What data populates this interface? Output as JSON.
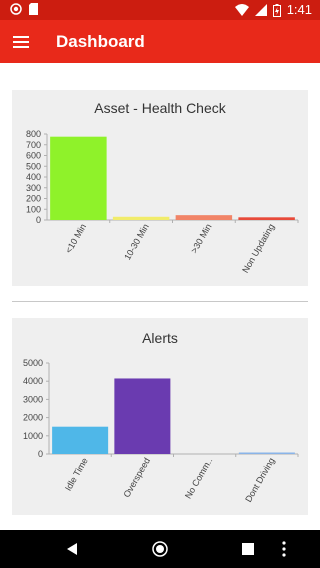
{
  "status_bar": {
    "time": "1:41",
    "icons": [
      "notification-icon",
      "sd-card-icon",
      "wifi-icon",
      "signal-icon",
      "battery-icon"
    ]
  },
  "app_bar": {
    "title": "Dashboard",
    "menu_icon": "hamburger-menu-icon"
  },
  "colors": {
    "status_bar": "#cc1d10",
    "app_bar": "#e8291a",
    "card_bg": "#efefef"
  },
  "chart_data": [
    {
      "type": "bar",
      "title": "Asset - Health Check",
      "categories": [
        "<10 Min",
        "10-30 Min",
        ">30 Min",
        "Non Updating"
      ],
      "values": [
        775,
        30,
        45,
        25
      ],
      "colors": [
        "#8ff22a",
        "#f1ec6a",
        "#f18467",
        "#e84a3a"
      ],
      "yticks": [
        "0",
        "100",
        "200",
        "300",
        "400",
        "500",
        "600",
        "700",
        "800"
      ],
      "ylim": [
        0,
        800
      ],
      "grid": false
    },
    {
      "type": "bar",
      "title": "Alerts",
      "categories": [
        "Idle Time",
        "Overspeed",
        "No Comm..",
        "Dont Driving"
      ],
      "values": [
        1500,
        4150,
        0,
        40
      ],
      "colors": [
        "#4fb7e8",
        "#6a3bb0",
        "#8ab4e8",
        "#8ab4e8"
      ],
      "yticks": [
        "0",
        "1000",
        "2000",
        "3000",
        "4000",
        "5000"
      ],
      "ylim": [
        0,
        5000
      ],
      "grid": false
    }
  ],
  "nav_bar": {
    "back": "back-icon",
    "home": "home-icon",
    "recents": "recents-icon",
    "more": "more-vertical-icon"
  }
}
